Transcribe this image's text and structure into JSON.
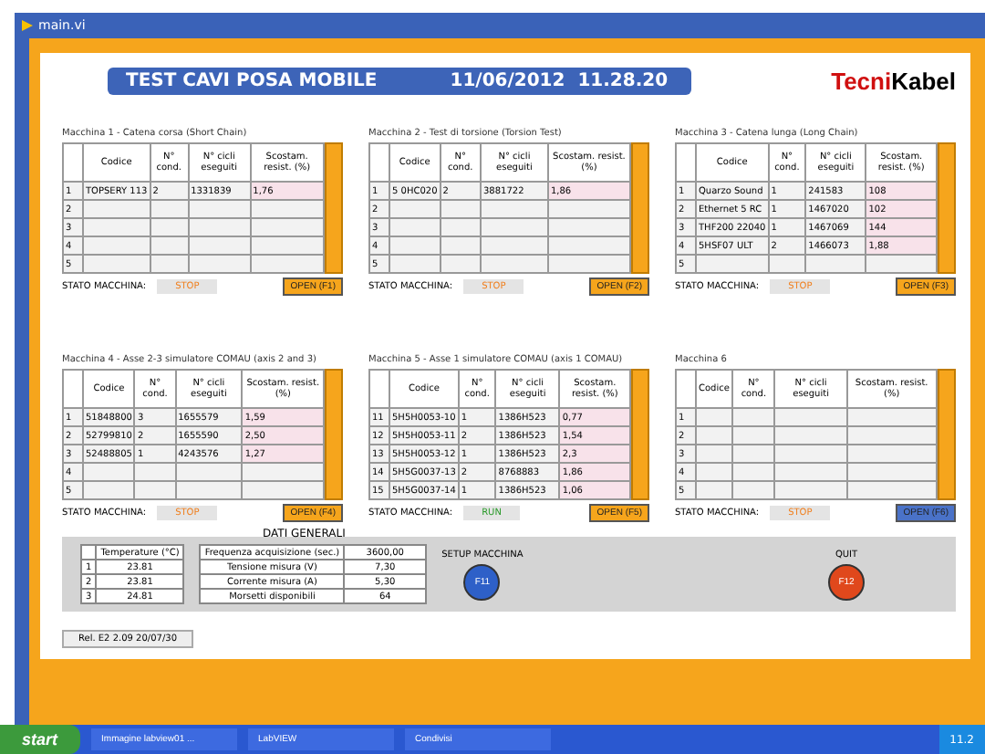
{
  "window": {
    "title": "main.vi"
  },
  "header": {
    "title": "TEST CAVI POSA MOBILE",
    "date": "11/06/2012",
    "time": "11.28.20",
    "logo_a": "Tecni",
    "logo_b": "Kabel"
  },
  "machines": [
    {
      "title": "Macchina 1 - Catena corsa (Short Chain)",
      "columns": [
        "",
        "Codice",
        "N° cond.",
        "N° cicli eseguiti",
        "Scostam. resist. (%)"
      ],
      "rows": [
        [
          "1",
          "TOPSERY 113",
          "2",
          "1331839",
          "1,76"
        ],
        [
          "2"
        ],
        [
          "3"
        ],
        [
          "4"
        ],
        [
          "5"
        ]
      ],
      "status_label": "STATO MACCHINA:",
      "status": "STOP",
      "running": false,
      "open_label": "OPEN (F1)",
      "active": true
    },
    {
      "title": "Macchina 2 - Test di torsione (Torsion Test)",
      "columns": [
        "",
        "Codice",
        "N° cond.",
        "N° cicli eseguiti",
        "Scostam. resist. (%)"
      ],
      "rows": [
        [
          "1",
          "5 0HC020",
          "2",
          "3881722",
          "1,86"
        ],
        [
          "2"
        ],
        [
          "3"
        ],
        [
          "4"
        ],
        [
          "5"
        ]
      ],
      "status_label": "STATO MACCHINA:",
      "status": "STOP",
      "running": false,
      "open_label": "OPEN (F2)",
      "active": true
    },
    {
      "title": "Macchina 3 - Catena lunga (Long Chain)",
      "columns": [
        "",
        "Codice",
        "N° cond.",
        "N° cicli eseguiti",
        "Scostam. resist. (%)"
      ],
      "rows": [
        [
          "1",
          "Quarzo Sound",
          "1",
          "241583",
          "108"
        ],
        [
          "2",
          "Ethernet 5 RC",
          "1",
          "1467020",
          "102"
        ],
        [
          "3",
          "THF200 22040",
          "1",
          "1467069",
          "144"
        ],
        [
          "4",
          "5HSF07 ULT",
          "2",
          "1466073",
          "1,88"
        ],
        [
          "5"
        ]
      ],
      "status_label": "STATO MACCHINA:",
      "status": "STOP",
      "running": false,
      "open_label": "OPEN (F3)",
      "active": true
    },
    {
      "title": "Macchina 4 - Asse 2-3 simulatore COMAU (axis 2 and 3)",
      "columns": [
        "",
        "Codice",
        "N° cond.",
        "N° cicli eseguiti",
        "Scostam. resist. (%)"
      ],
      "rows": [
        [
          "1",
          "51848800",
          "3",
          "1655579",
          "1,59"
        ],
        [
          "2",
          "52799810",
          "2",
          "1655590",
          "2,50"
        ],
        [
          "3",
          "52488805",
          "1",
          "4243576",
          "1,27"
        ],
        [
          "4"
        ],
        [
          "5"
        ]
      ],
      "status_label": "STATO MACCHINA:",
      "status": "STOP",
      "running": false,
      "open_label": "OPEN (F4)",
      "active": true
    },
    {
      "title": "Macchina 5 - Asse 1 simulatore COMAU (axis 1 COMAU)",
      "columns": [
        "",
        "Codice",
        "N° cond.",
        "N° cicli eseguiti",
        "Scostam. resist. (%)"
      ],
      "rows": [
        [
          "11",
          "5H5H0053-10",
          "1",
          "1386H523",
          "0,77"
        ],
        [
          "12",
          "5H5H0053-11",
          "2",
          "1386H523",
          "1,54"
        ],
        [
          "13",
          "5H5H0053-12",
          "1",
          "1386H523",
          "2,3"
        ],
        [
          "14",
          "5H5G0037-13",
          "2",
          "8768883",
          "1,86"
        ],
        [
          "15",
          "5H5G0037-14",
          "1",
          "1386H523",
          "1,06"
        ]
      ],
      "status_label": "STATO MACCHINA:",
      "status": "RUN",
      "running": true,
      "open_label": "OPEN (F5)",
      "active": true
    },
    {
      "title": "Macchina 6",
      "columns": [
        "",
        "Codice",
        "N° cond.",
        "N° cicli eseguiti",
        "Scostam. resist. (%)"
      ],
      "rows": [
        [
          "1"
        ],
        [
          "2"
        ],
        [
          "3"
        ],
        [
          "4"
        ],
        [
          "5"
        ]
      ],
      "status_label": "STATO MACCHINA:",
      "status": "STOP",
      "running": false,
      "open_label": "OPEN (F6)",
      "active": false
    }
  ],
  "general": {
    "title": "DATI GENERALI",
    "temp_header": "Temperature (°C)",
    "temps": [
      [
        "1",
        "23.81"
      ],
      [
        "2",
        "23.81"
      ],
      [
        "3",
        "24.81"
      ]
    ],
    "params": [
      [
        "Frequenza acquisizione (sec.)",
        "3600,00"
      ],
      [
        "Tensione misura (V)",
        "7,30"
      ],
      [
        "Corrente misura (A)",
        "5,30"
      ],
      [
        "Morsetti disponibili",
        "64"
      ]
    ],
    "setup": {
      "label": "SETUP MACCHINA",
      "key": "F11"
    },
    "quit": {
      "label": "QUIT",
      "key": "F12"
    }
  },
  "release": "Rel. E2 2.09 20/07/30",
  "taskbar": {
    "start": "start",
    "tasks": [
      "Immagine labview01 ...",
      "LabVIEW",
      "Condivisi"
    ],
    "clock": "11.2"
  }
}
